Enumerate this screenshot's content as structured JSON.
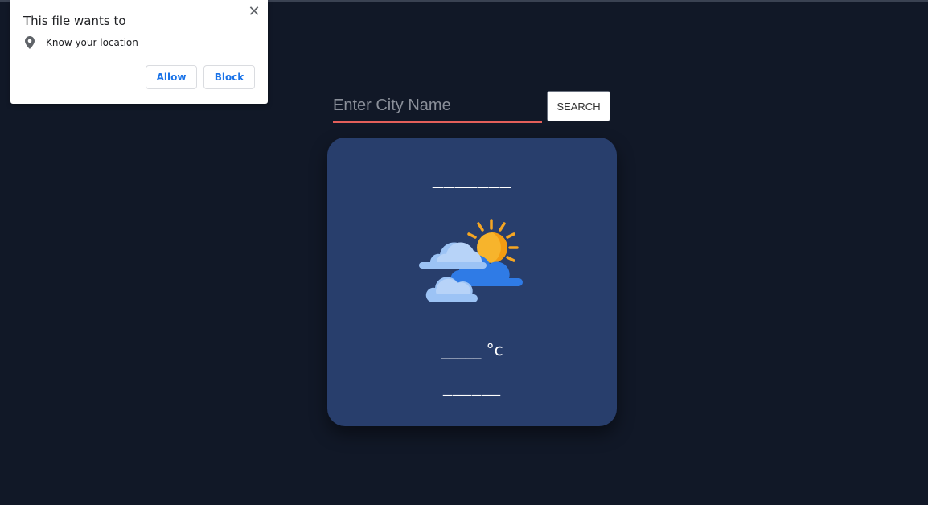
{
  "permission_popup": {
    "title": "This file wants to",
    "close_glyph": "✕",
    "request_icon": "location-pin-icon",
    "request_label": "Know your location",
    "allow_label": "Allow",
    "block_label": "Block"
  },
  "search": {
    "placeholder": "Enter City Name",
    "value": "",
    "button_label": "SEARCH"
  },
  "weather_card": {
    "city": "_______",
    "icon": "partly-cloudy-sun-icon",
    "temperature": "_____",
    "temperature_unit": "°c",
    "description": "______"
  },
  "colors": {
    "page_background": "#111827",
    "card_background": "#283e6c",
    "input_underline": "#e35f5a",
    "popup_button_text": "#1a73e8"
  }
}
